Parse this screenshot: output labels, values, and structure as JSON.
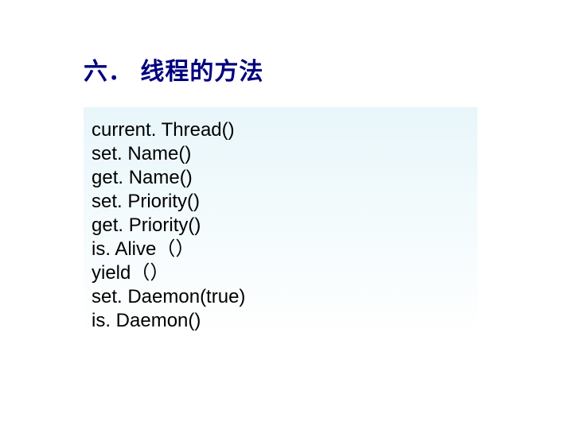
{
  "heading": "六．  线程的方法",
  "methods": [
    "current. Thread()",
    "set. Name()",
    "get. Name()",
    "set. Priority()",
    "get. Priority()",
    "is. Alive（）",
    "yield（）",
    "set. Daemon(true)",
    "is. Daemon()"
  ]
}
